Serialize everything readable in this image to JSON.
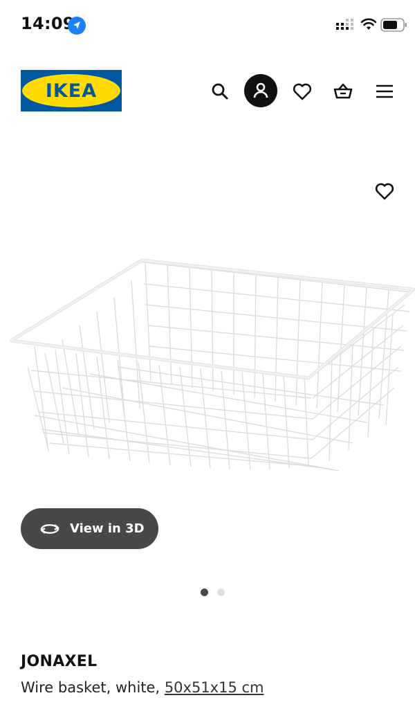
{
  "status_bar": {
    "time": "14:09",
    "icons": [
      "location-icon",
      "signal-icon",
      "wifi-icon",
      "battery-icon"
    ]
  },
  "header": {
    "logo_text": "IKEA",
    "brand_colors": {
      "blue": "#0058a3",
      "yellow": "#ffdb00"
    },
    "icons": [
      "search-icon",
      "account-icon",
      "heart-icon",
      "basket-icon",
      "hamburger-menu-icon"
    ]
  },
  "product": {
    "view3d_label": "View in 3D",
    "name": "JONAXEL",
    "description": "Wire basket, white,",
    "size": "50x51x15 cm",
    "carousel": {
      "count": 2,
      "active": 1
    }
  }
}
